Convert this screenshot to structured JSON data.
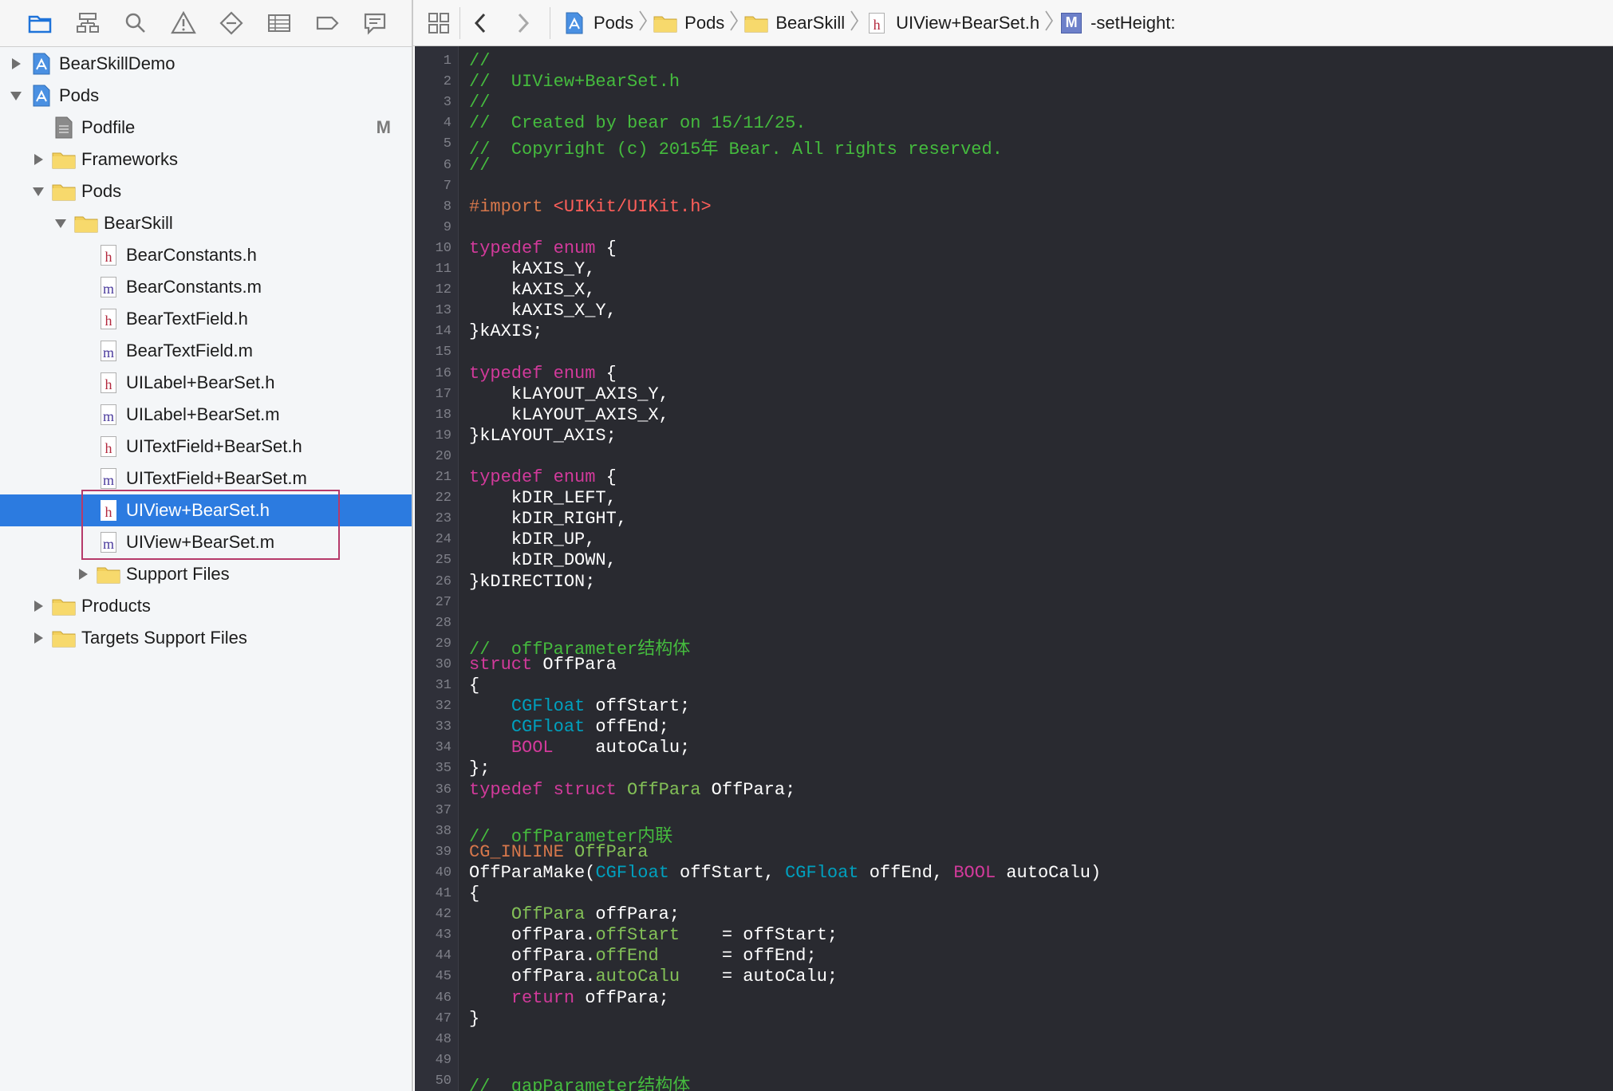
{
  "navigator": {
    "toolbar_icons": [
      "folder-icon",
      "hierarchy-icon",
      "search-icon",
      "warning-icon",
      "test-diamond-icon",
      "debug-list-icon",
      "breakpoint-icon",
      "report-icon"
    ],
    "items": [
      {
        "label": "BearSkillDemo",
        "icon": "project-icon",
        "disclosure": "collapsed",
        "depth": 0,
        "badge": ""
      },
      {
        "label": "Pods",
        "icon": "project-icon",
        "disclosure": "expanded",
        "depth": 0,
        "badge": ""
      },
      {
        "label": "Podfile",
        "icon": "document-icon",
        "disclosure": "none",
        "depth": 1,
        "badge": "M"
      },
      {
        "label": "Frameworks",
        "icon": "folder-icon",
        "disclosure": "collapsed",
        "depth": 1,
        "badge": ""
      },
      {
        "label": "Pods",
        "icon": "folder-icon",
        "disclosure": "expanded",
        "depth": 1,
        "badge": ""
      },
      {
        "label": "BearSkill",
        "icon": "folder-icon",
        "disclosure": "expanded",
        "depth": 2,
        "badge": ""
      },
      {
        "label": "BearConstants.h",
        "icon": "h-file-icon",
        "disclosure": "none",
        "depth": 3,
        "badge": ""
      },
      {
        "label": "BearConstants.m",
        "icon": "m-file-icon",
        "disclosure": "none",
        "depth": 3,
        "badge": ""
      },
      {
        "label": "BearTextField.h",
        "icon": "h-file-icon",
        "disclosure": "none",
        "depth": 3,
        "badge": ""
      },
      {
        "label": "BearTextField.m",
        "icon": "m-file-icon",
        "disclosure": "none",
        "depth": 3,
        "badge": ""
      },
      {
        "label": "UILabel+BearSet.h",
        "icon": "h-file-icon",
        "disclosure": "none",
        "depth": 3,
        "badge": ""
      },
      {
        "label": "UILabel+BearSet.m",
        "icon": "m-file-icon",
        "disclosure": "none",
        "depth": 3,
        "badge": ""
      },
      {
        "label": "UITextField+BearSet.h",
        "icon": "h-file-icon",
        "disclosure": "none",
        "depth": 3,
        "badge": ""
      },
      {
        "label": "UITextField+BearSet.m",
        "icon": "m-file-icon",
        "disclosure": "none",
        "depth": 3,
        "badge": ""
      },
      {
        "label": "UIView+BearSet.h",
        "icon": "h-file-icon",
        "disclosure": "none",
        "depth": 3,
        "badge": "",
        "selected": true
      },
      {
        "label": "UIView+BearSet.m",
        "icon": "m-file-icon",
        "disclosure": "none",
        "depth": 3,
        "badge": ""
      },
      {
        "label": "Support Files",
        "icon": "folder-icon",
        "disclosure": "collapsed",
        "depth": 3,
        "badge": ""
      },
      {
        "label": "Products",
        "icon": "folder-icon",
        "disclosure": "collapsed",
        "depth": 1,
        "badge": ""
      },
      {
        "label": "Targets Support Files",
        "icon": "folder-icon",
        "disclosure": "collapsed",
        "depth": 1,
        "badge": ""
      }
    ]
  },
  "jumpbar": {
    "crumbs": [
      {
        "label": "Pods",
        "icon": "project-icon"
      },
      {
        "label": "Pods",
        "icon": "folder-icon"
      },
      {
        "label": "BearSkill",
        "icon": "folder-icon"
      },
      {
        "label": "UIView+BearSet.h",
        "icon": "h-file-icon"
      },
      {
        "label": "-setHeight:",
        "icon": "method-icon"
      }
    ],
    "method_icon_letter": "M"
  },
  "editor": {
    "colors": {
      "background": "#292a30",
      "comment": "#45bb3e",
      "preprocessor": "#d6774b",
      "string": "#ff5f5a",
      "keyword": "#d23a9b",
      "system_type": "#00a0be",
      "project_type": "#83c057",
      "plain": "#ffffff"
    },
    "lines": [
      [
        [
          "comment",
          "//"
        ]
      ],
      [
        [
          "comment",
          "//  UIView+BearSet.h"
        ]
      ],
      [
        [
          "comment",
          "//"
        ]
      ],
      [
        [
          "comment",
          "//  Created by bear on 15/11/25."
        ]
      ],
      [
        [
          "comment",
          "//  Copyright (c) 2015年 Bear. All rights reserved."
        ]
      ],
      [
        [
          "comment",
          "//"
        ]
      ],
      [],
      [
        [
          "pre",
          "#import "
        ],
        [
          "str",
          "<UIKit/UIKit.h>"
        ]
      ],
      [],
      [
        [
          "kw",
          "typedef"
        ],
        [
          "plain",
          " "
        ],
        [
          "kw",
          "enum"
        ],
        [
          "plain",
          " {"
        ]
      ],
      [
        [
          "plain",
          "    kAXIS_Y,"
        ]
      ],
      [
        [
          "plain",
          "    kAXIS_X,"
        ]
      ],
      [
        [
          "plain",
          "    kAXIS_X_Y,"
        ]
      ],
      [
        [
          "plain",
          "}kAXIS;"
        ]
      ],
      [],
      [
        [
          "kw",
          "typedef"
        ],
        [
          "plain",
          " "
        ],
        [
          "kw",
          "enum"
        ],
        [
          "plain",
          " {"
        ]
      ],
      [
        [
          "plain",
          "    kLAYOUT_AXIS_Y,"
        ]
      ],
      [
        [
          "plain",
          "    kLAYOUT_AXIS_X,"
        ]
      ],
      [
        [
          "plain",
          "}kLAYOUT_AXIS;"
        ]
      ],
      [],
      [
        [
          "kw",
          "typedef"
        ],
        [
          "plain",
          " "
        ],
        [
          "kw",
          "enum"
        ],
        [
          "plain",
          " {"
        ]
      ],
      [
        [
          "plain",
          "    kDIR_LEFT,"
        ]
      ],
      [
        [
          "plain",
          "    kDIR_RIGHT,"
        ]
      ],
      [
        [
          "plain",
          "    kDIR_UP,"
        ]
      ],
      [
        [
          "plain",
          "    kDIR_DOWN,"
        ]
      ],
      [
        [
          "plain",
          "}kDIRECTION;"
        ]
      ],
      [],
      [],
      [
        [
          "comment",
          "//  offParameter结构体"
        ]
      ],
      [
        [
          "kw",
          "struct"
        ],
        [
          "plain",
          " OffPara"
        ]
      ],
      [
        [
          "plain",
          "{"
        ]
      ],
      [
        [
          "plain",
          "    "
        ],
        [
          "type",
          "CGFloat"
        ],
        [
          "plain",
          " offStart;"
        ]
      ],
      [
        [
          "plain",
          "    "
        ],
        [
          "type",
          "CGFloat"
        ],
        [
          "plain",
          " offEnd;"
        ]
      ],
      [
        [
          "plain",
          "    "
        ],
        [
          "kw",
          "BOOL"
        ],
        [
          "plain",
          "    autoCalu;"
        ]
      ],
      [
        [
          "plain",
          "};"
        ]
      ],
      [
        [
          "kw",
          "typedef"
        ],
        [
          "plain",
          " "
        ],
        [
          "kw",
          "struct"
        ],
        [
          "plain",
          " "
        ],
        [
          "prj",
          "OffPara"
        ],
        [
          "plain",
          " OffPara;"
        ]
      ],
      [],
      [
        [
          "comment",
          "//  offParameter内联"
        ]
      ],
      [
        [
          "pre",
          "CG_INLINE"
        ],
        [
          "plain",
          " "
        ],
        [
          "prj",
          "OffPara"
        ]
      ],
      [
        [
          "plain",
          "OffParaMake("
        ],
        [
          "type",
          "CGFloat"
        ],
        [
          "plain",
          " offStart, "
        ],
        [
          "type",
          "CGFloat"
        ],
        [
          "plain",
          " offEnd, "
        ],
        [
          "kw",
          "BOOL"
        ],
        [
          "plain",
          " autoCalu)"
        ]
      ],
      [
        [
          "plain",
          "{"
        ]
      ],
      [
        [
          "plain",
          "    "
        ],
        [
          "prj",
          "OffPara"
        ],
        [
          "plain",
          " offPara;"
        ]
      ],
      [
        [
          "plain",
          "    offPara."
        ],
        [
          "prj",
          "offStart"
        ],
        [
          "plain",
          "    = offStart;"
        ]
      ],
      [
        [
          "plain",
          "    offPara."
        ],
        [
          "prj",
          "offEnd"
        ],
        [
          "plain",
          "      = offEnd;"
        ]
      ],
      [
        [
          "plain",
          "    offPara."
        ],
        [
          "prj",
          "autoCalu"
        ],
        [
          "plain",
          "    = autoCalu;"
        ]
      ],
      [
        [
          "plain",
          "    "
        ],
        [
          "kw",
          "return"
        ],
        [
          "plain",
          " offPara;"
        ]
      ],
      [
        [
          "plain",
          "}"
        ]
      ],
      [],
      [],
      [
        [
          "comment",
          "//  gapParameter结构体"
        ]
      ]
    ]
  }
}
